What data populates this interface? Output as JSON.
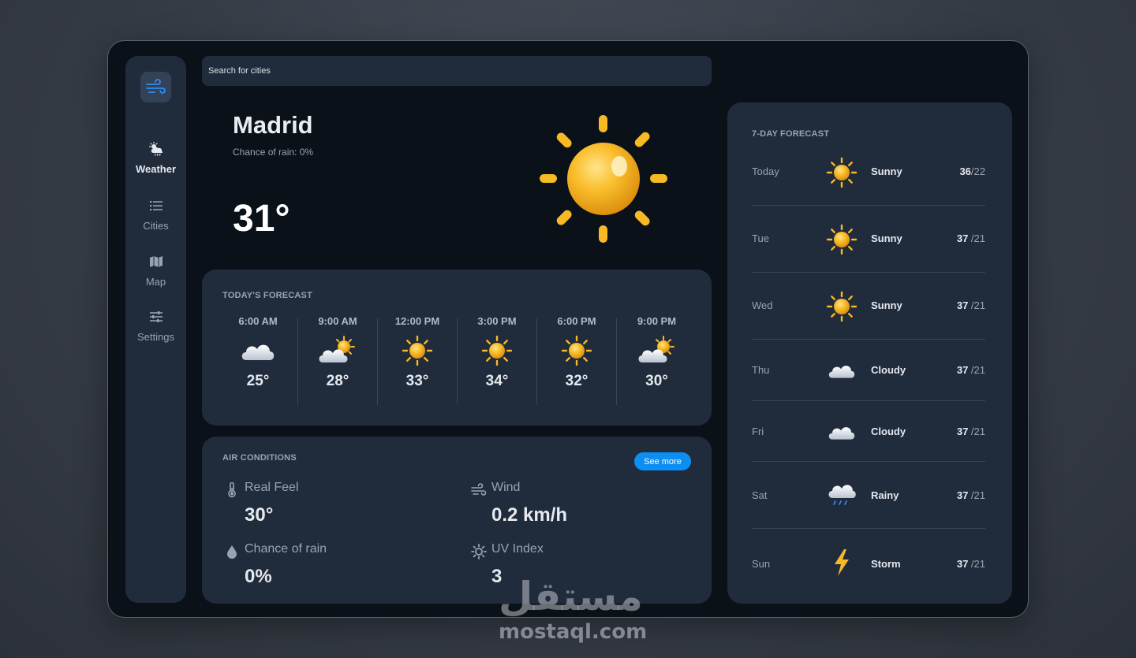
{
  "search": {
    "placeholder": "Search for cities"
  },
  "sidebar": {
    "logo_icon": "wind-icon",
    "items": [
      {
        "label": "Weather",
        "icon": "cloud-sun-rain-icon",
        "active": true
      },
      {
        "label": "Cities",
        "icon": "list-icon",
        "active": false
      },
      {
        "label": "Map",
        "icon": "map-icon",
        "active": false
      },
      {
        "label": "Settings",
        "icon": "sliders-icon",
        "active": false
      }
    ]
  },
  "current": {
    "city": "Madrid",
    "rain_chance": "Chance of rain: 0%",
    "temp": "31°",
    "icon": "sun-icon"
  },
  "today_forecast": {
    "title": "TODAY'S FORECAST",
    "hours": [
      {
        "time": "6:00 AM",
        "temp": "25°",
        "icon": "cloud-icon"
      },
      {
        "time": "9:00 AM",
        "temp": "28°",
        "icon": "partly-cloudy-icon"
      },
      {
        "time": "12:00 PM",
        "temp": "33°",
        "icon": "sun-icon"
      },
      {
        "time": "3:00 PM",
        "temp": "34°",
        "icon": "sun-icon"
      },
      {
        "time": "6:00 PM",
        "temp": "32°",
        "icon": "sun-icon"
      },
      {
        "time": "9:00 PM",
        "temp": "30°",
        "icon": "partly-cloudy-icon"
      }
    ]
  },
  "air_conditions": {
    "title": "AIR CONDITIONS",
    "see_more": "See more",
    "items": [
      {
        "label": "Real Feel",
        "value": "30°",
        "icon": "thermometer-icon"
      },
      {
        "label": "Wind",
        "value": "0.2 km/h",
        "icon": "wind-icon"
      },
      {
        "label": "Chance of rain",
        "value": "0%",
        "icon": "droplet-icon"
      },
      {
        "label": "UV Index",
        "value": "3",
        "icon": "sun-outline-icon"
      }
    ]
  },
  "week_forecast": {
    "title": "7-DAY FORECAST",
    "days": [
      {
        "day": "Today",
        "condition": "Sunny",
        "high": "36",
        "low": "/22",
        "icon": "sun-icon"
      },
      {
        "day": "Tue",
        "condition": "Sunny",
        "high": "37",
        "low": " /21",
        "icon": "sun-icon"
      },
      {
        "day": "Wed",
        "condition": "Sunny",
        "high": "37",
        "low": " /21",
        "icon": "sun-icon"
      },
      {
        "day": "Thu",
        "condition": "Cloudy",
        "high": "37",
        "low": " /21",
        "icon": "cloud-icon"
      },
      {
        "day": "Fri",
        "condition": "Cloudy",
        "high": "37",
        "low": " /21",
        "icon": "cloud-icon"
      },
      {
        "day": "Sat",
        "condition": "Rainy",
        "high": "37",
        "low": " /21",
        "icon": "rain-cloud-icon"
      },
      {
        "day": "Sun",
        "condition": "Storm",
        "high": "37",
        "low": " /21",
        "icon": "lightning-icon"
      }
    ]
  },
  "watermark": {
    "arabic": "مستقل",
    "latin": "mostaql.com"
  },
  "colors": {
    "accent": "#0d8ef3",
    "frame": "#0b1119",
    "card": "#202b3b",
    "sun": "#f7b924"
  }
}
